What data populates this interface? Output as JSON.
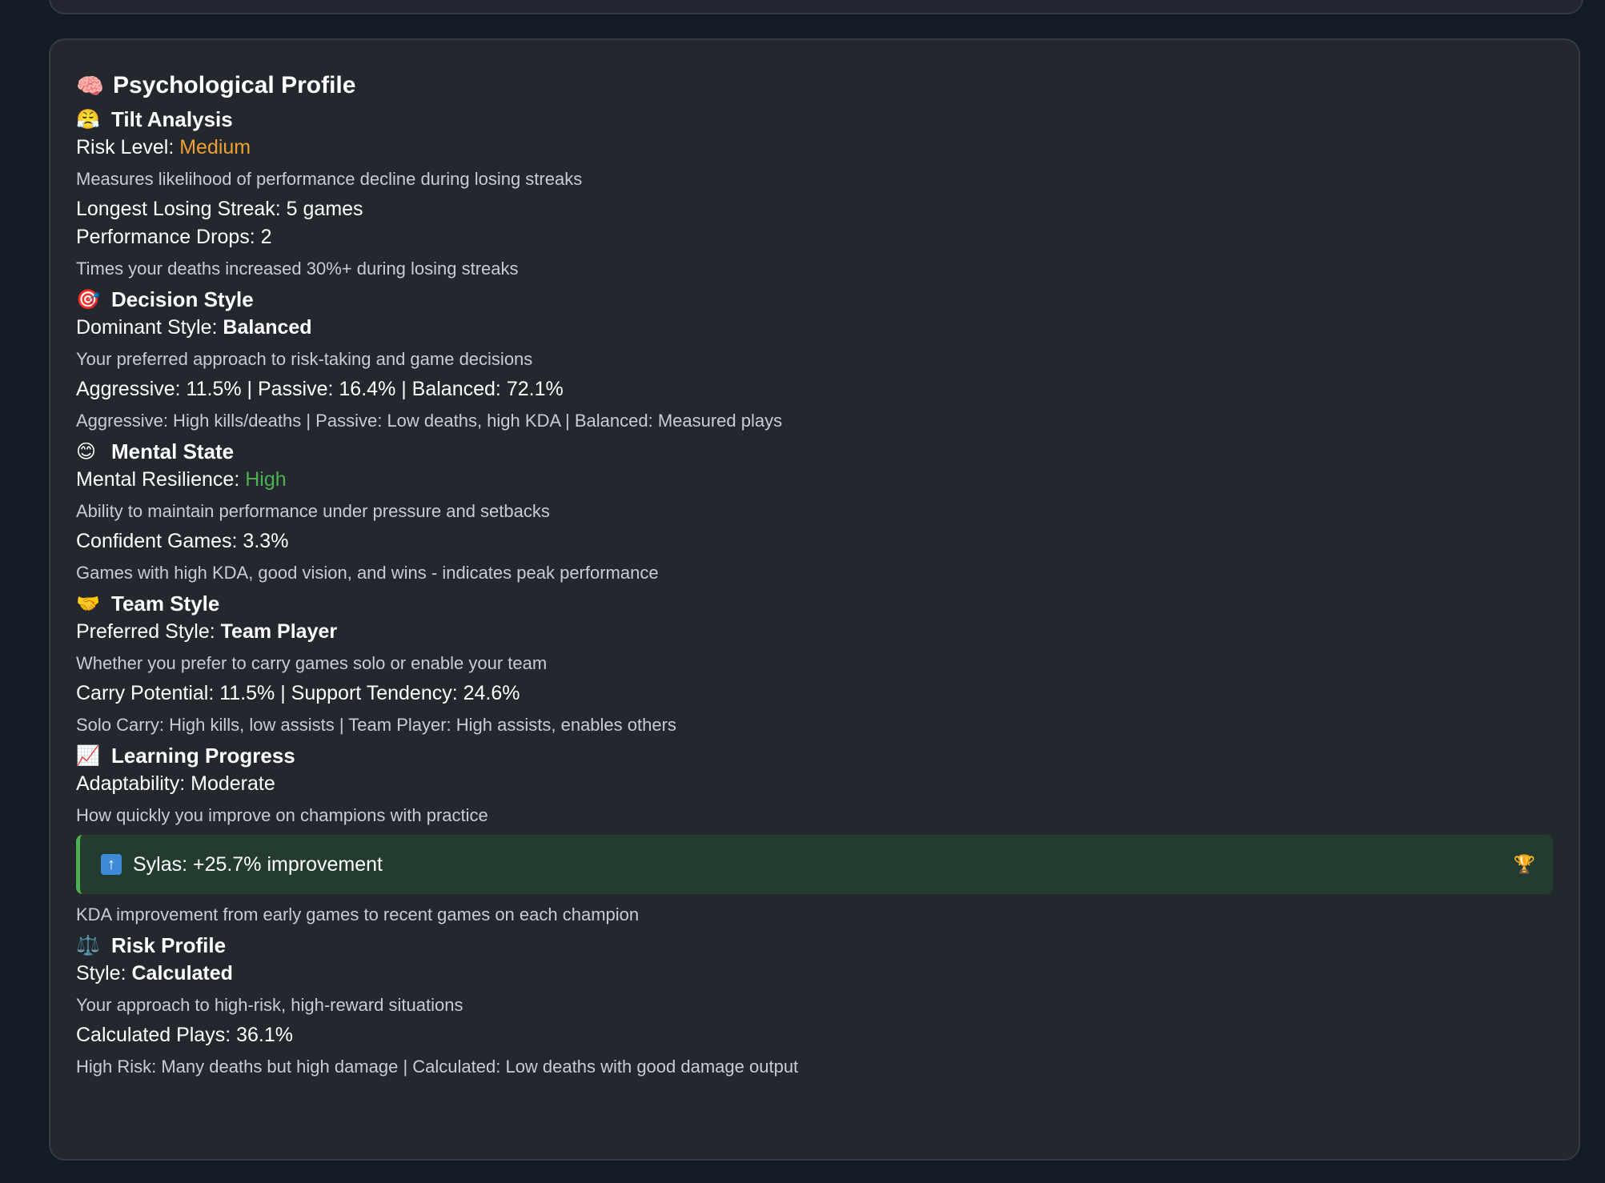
{
  "profile": {
    "title_icon": "brain-icon",
    "title": "Psychological Profile",
    "tilt": {
      "icon": "steaming-face-icon",
      "heading": "Tilt Analysis",
      "risk_label": "Risk Level: ",
      "risk_value": "Medium",
      "risk_color": "#f0a030",
      "risk_desc": "Measures likelihood of performance decline during losing streaks",
      "streak": "Longest Losing Streak: 5 games",
      "drops": "Performance Drops: 2",
      "drops_desc": "Times your deaths increased 30%+ during losing streaks"
    },
    "decision": {
      "icon": "target-icon",
      "heading": "Decision Style",
      "dominant_label": "Dominant Style: ",
      "dominant_value": "Balanced",
      "dominant_desc": "Your preferred approach to risk-taking and game decisions",
      "breakdown": "Aggressive: 11.5% | Passive: 16.4% | Balanced: 72.1%",
      "breakdown_desc": "Aggressive: High kills/deaths | Passive: Low deaths, high KDA | Balanced: Measured plays"
    },
    "mental": {
      "icon": "smiling-face-icon",
      "heading": "Mental State",
      "resilience_label": "Mental Resilience: ",
      "resilience_value": "High",
      "resilience_color": "#4caf50",
      "resilience_desc": "Ability to maintain performance under pressure and setbacks",
      "confident": "Confident Games: 3.3%",
      "confident_desc": "Games with high KDA, good vision, and wins - indicates peak performance"
    },
    "team": {
      "icon": "handshake-icon",
      "heading": "Team Style",
      "style_label": "Preferred Style: ",
      "style_value": "Team Player",
      "style_desc": "Whether you prefer to carry games solo or enable your team",
      "potential": "Carry Potential: 11.5% | Support Tendency: 24.6%",
      "potential_desc": "Solo Carry: High kills, low assists | Team Player: High assists, enables others"
    },
    "learning": {
      "icon": "chart-increasing-icon",
      "heading": "Learning Progress",
      "adaptability": "Adaptability: Moderate",
      "adaptability_desc": "How quickly you improve on champions with practice",
      "improvement_icon": "up-arrow-icon",
      "improvement": "Sylas: +25.7% improvement",
      "improvement_badge_icon": "trophy-icon",
      "improvement_desc": "KDA improvement from early games to recent games on each champion"
    },
    "risk": {
      "icon": "balance-scale-icon",
      "heading": "Risk Profile",
      "style_label": "Style: ",
      "style_value": "Calculated",
      "style_desc": "Your approach to high-risk, high-reward situations",
      "plays": "Calculated Plays: 36.1%",
      "plays_desc": "High Risk: Many deaths but high damage | Calculated: Low deaths with good damage output"
    }
  }
}
